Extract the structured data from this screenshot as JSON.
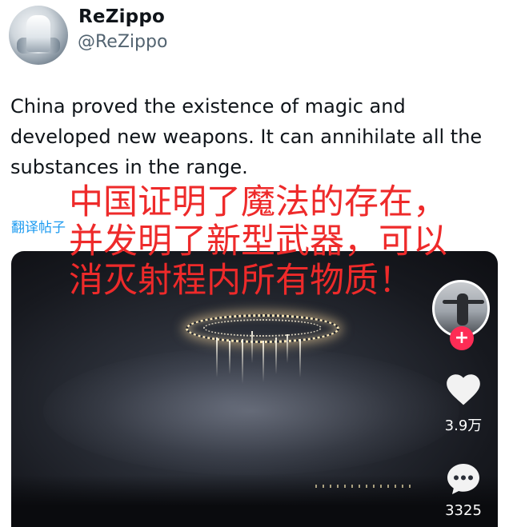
{
  "author": {
    "display_name": "ReZippo",
    "handle": "@ReZippo"
  },
  "tweet": {
    "text": "China proved the existence of magic and developed new weapons. It can annihilate all the substances in the range.",
    "translate_label": "翻译帖子"
  },
  "overlay_caption": {
    "lines": [
      "中国证明了魔法的存在，",
      "并发明了新型武器，可以",
      "消灭射程内所有物质！"
    ]
  },
  "video": {
    "like_count": "3.9万",
    "comment_count": "3325",
    "follow_symbol": "+"
  },
  "icons": {
    "heart": "heart-icon",
    "comment": "comment-bubble-icon",
    "follow": "plus-icon"
  },
  "colors": {
    "overlay_text": "#ee2a2a",
    "link": "#1d9bf0",
    "handle": "#536471",
    "follow_button": "#fe2c55"
  }
}
